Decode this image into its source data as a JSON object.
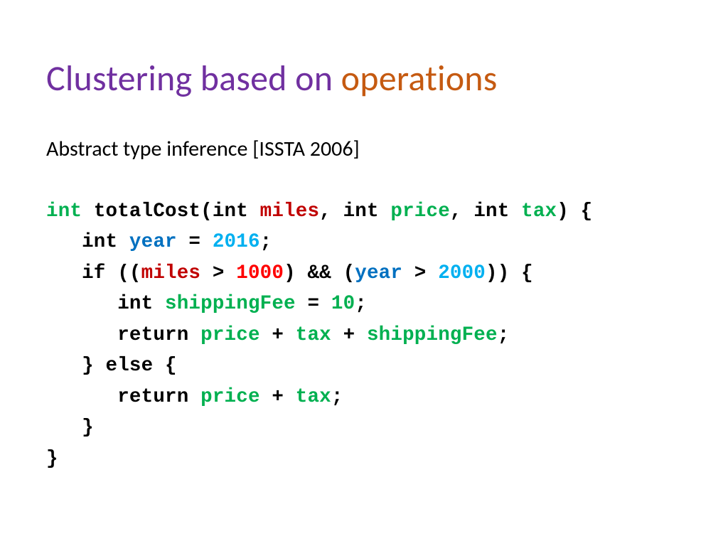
{
  "title": {
    "part1": "Clustering based on ",
    "part2": "operations"
  },
  "subtitle": "Abstract type inference [ISSTA 2006]",
  "tokens": {
    "int_green": "int",
    "int_black": "int",
    "totalCost": "totalCost",
    "miles": "miles",
    "price": "price",
    "tax": "tax",
    "year": "year",
    "shippingFee": "shippingFee",
    "val2016": "2016",
    "val1000": "1000",
    "val2000": "2000",
    "val10": "10",
    "if": "if",
    "return": "return",
    "else": "else"
  },
  "punct": {
    "open_paren": "(",
    "close_paren": ")",
    "open_brace": "{",
    "close_brace": "}",
    "comma_sp": ", ",
    "semi": ";",
    "sp": " ",
    "eq": " = ",
    "gt": " > ",
    "amp": " && ",
    "plus": " + "
  }
}
